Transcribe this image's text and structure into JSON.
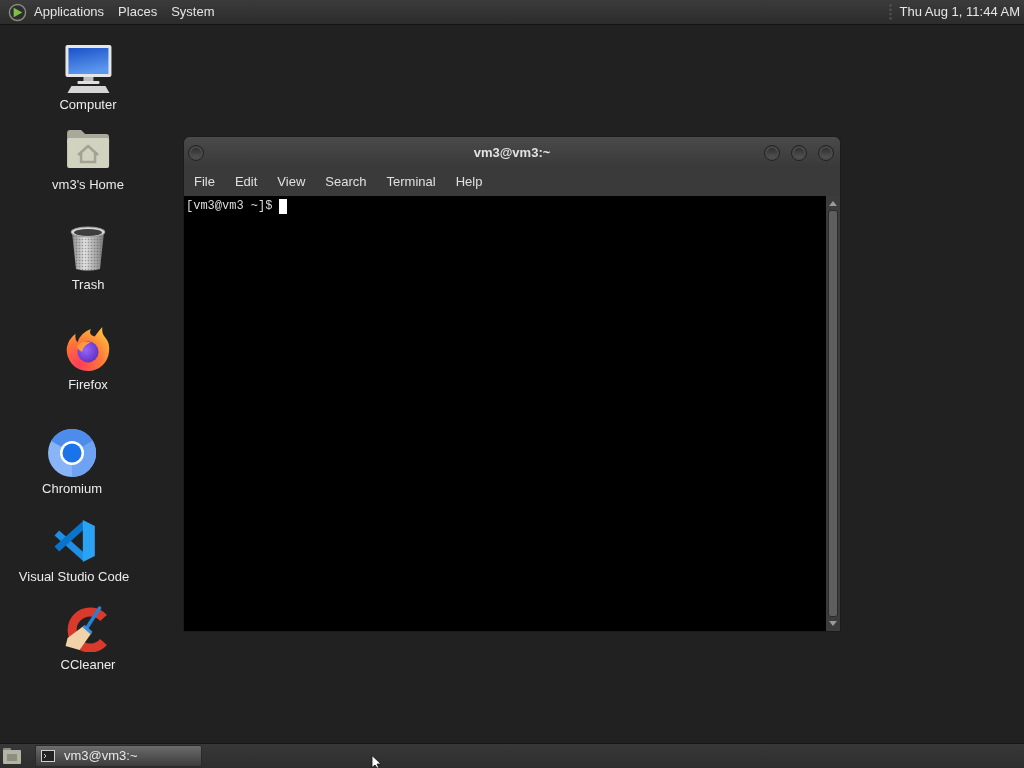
{
  "top_panel": {
    "menus": [
      "Applications",
      "Places",
      "System"
    ],
    "clock": "Thu Aug 1, 11:44 AM"
  },
  "desktop_icons": [
    {
      "label": "Computer",
      "kind": "computer"
    },
    {
      "label": "vm3's Home",
      "kind": "home"
    },
    {
      "label": "Trash",
      "kind": "trash"
    },
    {
      "label": "Firefox",
      "kind": "firefox"
    },
    {
      "label": "Chromium",
      "kind": "chromium"
    },
    {
      "label": "Visual Studio Code",
      "kind": "vscode"
    },
    {
      "label": "CCleaner",
      "kind": "ccleaner"
    }
  ],
  "window": {
    "title": "vm3@vm3:~",
    "menu": [
      "File",
      "Edit",
      "View",
      "Search",
      "Terminal",
      "Help"
    ],
    "terminal_lines": [
      "[vm3@vm3 ~]$"
    ]
  },
  "taskbar": {
    "tasks": [
      {
        "label": "vm3@vm3:~",
        "selected": true
      }
    ]
  }
}
